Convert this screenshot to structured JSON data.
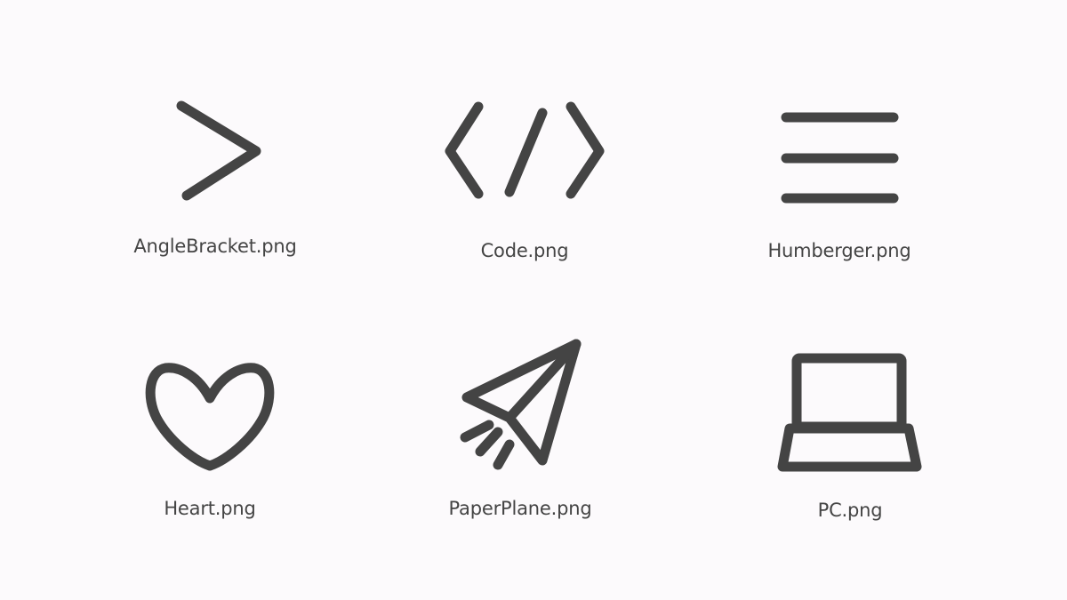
{
  "icons": [
    {
      "icon": "angle-bracket-icon",
      "filename": "AngleBracket.png"
    },
    {
      "icon": "code-icon",
      "filename": "Code.png"
    },
    {
      "icon": "hamburger-icon",
      "filename": "Humberger.png"
    },
    {
      "icon": "heart-icon",
      "filename": "Heart.png"
    },
    {
      "icon": "paper-plane-icon",
      "filename": "PaperPlane.png"
    },
    {
      "icon": "pc-icon",
      "filename": "PC.png"
    }
  ],
  "colors": {
    "background": "#fcfafc",
    "icon_stroke": "#444444",
    "text": "#444444"
  }
}
